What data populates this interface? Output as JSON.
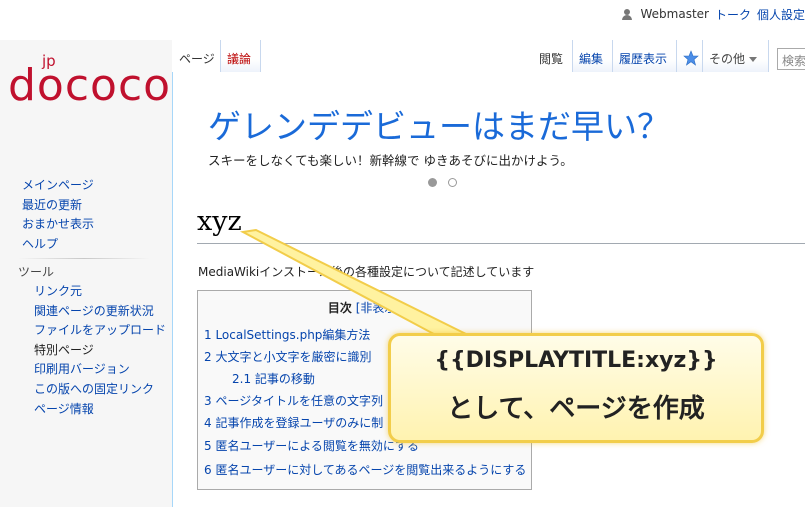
{
  "personal": {
    "username": "Webmaster",
    "talk": "トーク",
    "settings": "個人設定"
  },
  "logo": {
    "superscript": "jp",
    "name": "dococo"
  },
  "sidebar": {
    "nav": [
      "メインページ",
      "最近の更新",
      "おまかせ表示",
      "ヘルプ"
    ],
    "tools_heading": "ツール",
    "tools": [
      "リンク元",
      "関連ページの更新状況",
      "ファイルをアップロード",
      "特別ページ",
      "印刷用バージョン",
      "この版への固定リンク",
      "ページ情報"
    ]
  },
  "tabs": {
    "page": "ページ",
    "talk": "議論",
    "read": "閲覧",
    "edit": "編集",
    "history": "履歴表示",
    "more": "その他",
    "star_icon": "star-icon"
  },
  "search": {
    "placeholder": "検索"
  },
  "banner": {
    "title": "ゲレンデデビューはまだ早い？",
    "subtitle": "スキーをしなくても楽しい！新幹線で ゆきあそびに出かけよう。"
  },
  "page": {
    "title": "xyz",
    "intro": "MediaWikiインストール後の各種設定について記述しています"
  },
  "toc": {
    "heading": "目次",
    "toggle": "[非表示]",
    "items": [
      "1 LocalSettings.php編集方法",
      "2 大文字と小文字を厳密に識別",
      "2.1 記事の移動",
      "3 ページタイトルを任意の文字列",
      "4 記事作成を登録ユーザのみに制",
      "5 匿名ユーザーによる閲覧を無効にする",
      "6 匿名ユーザーに対してあるページを閲覧出来るようにする"
    ]
  },
  "callout": {
    "line1": "{{DISPLAYTITLE:xyz}}",
    "line2": "として、ページを作成"
  },
  "colors": {
    "accent": "#c0112e",
    "link": "#0645ad",
    "banner": "#1a6ad8",
    "callout_border": "#f2cd4a"
  }
}
